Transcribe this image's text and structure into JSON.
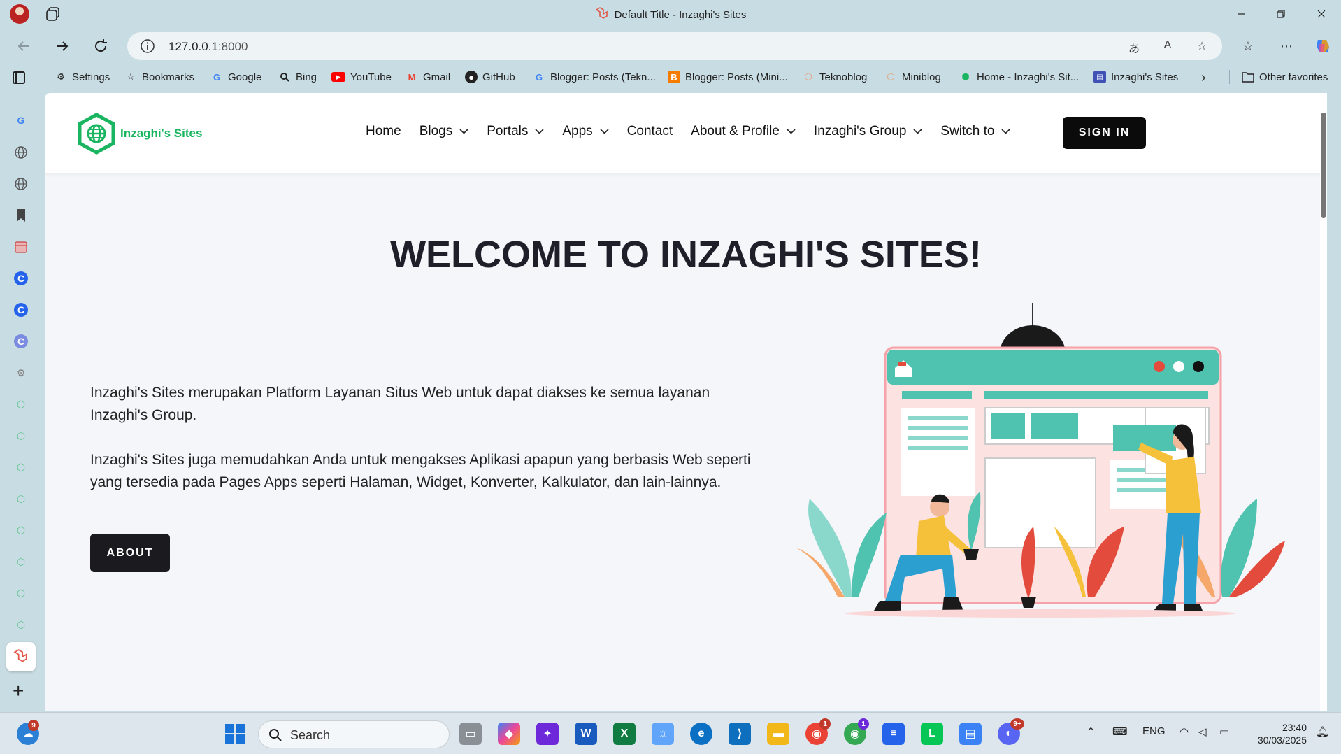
{
  "browser": {
    "window_title": "Default Title - Inzaghi's Sites",
    "url_host": "127.0.0.1",
    "url_port": ":8000"
  },
  "bookmarks": [
    {
      "label": "Settings",
      "icon": "gear-icon"
    },
    {
      "label": "Bookmarks",
      "icon": "star-list-icon"
    },
    {
      "label": "Google",
      "icon": "google-icon"
    },
    {
      "label": "Bing",
      "icon": "search-icon"
    },
    {
      "label": "YouTube",
      "icon": "youtube-icon"
    },
    {
      "label": "Gmail",
      "icon": "gmail-icon"
    },
    {
      "label": "GitHub",
      "icon": "github-icon"
    },
    {
      "label": "Blogger: Posts (Tekn...",
      "icon": "google-icon"
    },
    {
      "label": "Blogger: Posts (Mini...",
      "icon": "blogger-icon"
    },
    {
      "label": "Teknoblog",
      "icon": "hexagon-icon"
    },
    {
      "label": "Miniblog",
      "icon": "hexagon-icon"
    },
    {
      "label": "Home - Inzaghi's Sit...",
      "icon": "hexagon-icon"
    },
    {
      "label": "Inzaghi's Sites",
      "icon": "layout-icon"
    }
  ],
  "other_favorites": "Other favorites",
  "site": {
    "logo_text": "Inzaghi's Sites",
    "menu": [
      {
        "label": "Home",
        "dropdown": false
      },
      {
        "label": "Blogs",
        "dropdown": true
      },
      {
        "label": "Portals",
        "dropdown": true
      },
      {
        "label": "Apps",
        "dropdown": true
      },
      {
        "label": "Contact",
        "dropdown": false
      },
      {
        "label": "About & Profile",
        "dropdown": true
      },
      {
        "label": "Inzaghi's Group",
        "dropdown": true
      },
      {
        "label": "Switch to",
        "dropdown": true
      }
    ],
    "signin_label": "SIGN IN",
    "hero_title": "WELCOME TO INZAGHI'S SITES!",
    "hero_paragraph_1": "Inzaghi's Sites merupakan Platform Layanan Situs Web untuk dapat diakses ke semua layanan Inzaghi's Group.",
    "hero_paragraph_2": "Inzaghi's Sites juga memudahkan Anda untuk mengakses Aplikasi apapun yang berbasis Web seperti yang tersedia pada Pages Apps seperti Halaman, Widget, Konverter, Kalkulator, dan lain-lainnya.",
    "about_label": "ABOUT",
    "brand_green": "#19b561"
  },
  "taskbar": {
    "search_label": "Search",
    "weather_badge": "9",
    "chrome_badge_1": "1",
    "chrome_badge_2": "1",
    "discord_badge": "9+",
    "language": "ENG",
    "time": "23:40",
    "date": "30/03/2025"
  }
}
